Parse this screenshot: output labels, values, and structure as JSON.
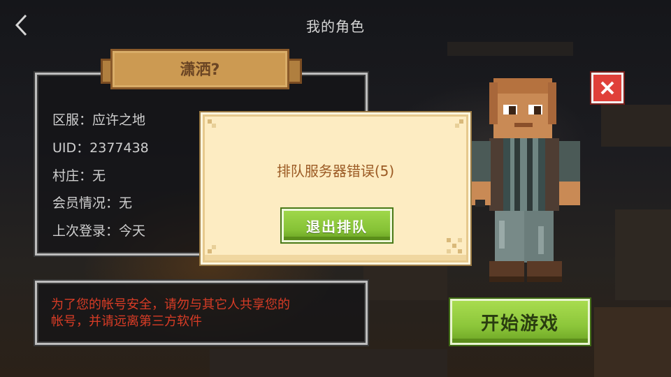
{
  "header": {
    "title": "我的角色"
  },
  "profile": {
    "name": "潇洒?",
    "server_line": "区服：应许之地",
    "uid_line": "UID：2377438",
    "village_line": "村庄：无",
    "membership_line": "会员情况：无",
    "last_login_line": "上次登录：今天"
  },
  "warning": {
    "line1": "为了您的帐号安全，请勿与其它人共享您的",
    "line2": "帐号，并请远离第三方软件"
  },
  "dialog": {
    "message": "排队服务器错误(5)",
    "exit_button_label": "退出排队"
  },
  "actions": {
    "start_button_label": "开始游戏"
  },
  "icons": {
    "back": "chevron-left-icon",
    "close": "close-icon"
  },
  "colors": {
    "accent_green": "#8cc63a",
    "close_red": "#e0403a",
    "warning_red": "#d83c26",
    "dialog_bg": "#fdecc2",
    "plaque_wood": "#cc9a52"
  }
}
